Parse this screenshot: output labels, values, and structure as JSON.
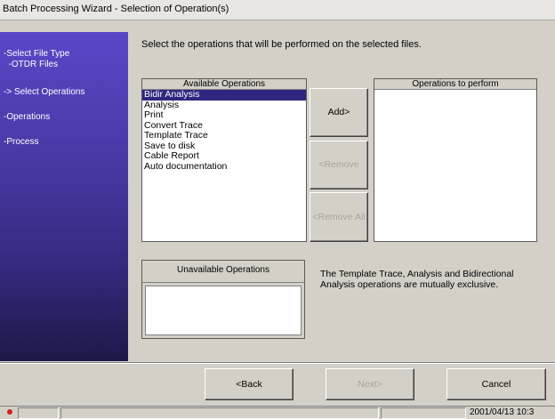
{
  "window": {
    "title": "Batch Processing Wizard - Selection of Operation(s)"
  },
  "sidebar": {
    "steps": [
      {
        "label": "-Select File Type"
      },
      {
        "label": "  -OTDR Files"
      },
      {
        "label": "-> Select Operations"
      },
      {
        "label": "-Operations"
      },
      {
        "label": "-Process"
      }
    ]
  },
  "main": {
    "instruction": "Select the operations that will be performed on the selected files.",
    "available": {
      "header": "Available Operations",
      "items": [
        "Bidir Analysis",
        "Analysis",
        "Print",
        "Convert Trace",
        "Template Trace",
        "Save to disk",
        "Cable Report",
        "Auto documentation"
      ],
      "selected_index": 0
    },
    "to_perform": {
      "header": "Operations to perform",
      "items": []
    },
    "unavailable": {
      "header": "Unavailable Operations",
      "items": []
    },
    "buttons": {
      "add": "Add>",
      "remove": "<Remove",
      "remove_all": "<Remove All"
    },
    "note": "The Template Trace, Analysis and Bidirectional Analysis operations are mutually exclusive."
  },
  "footer": {
    "back": "<Back",
    "next": "Next>",
    "cancel": "Cancel"
  },
  "statusbar": {
    "datetime": "2001/04/13 10:3"
  },
  "colors": {
    "selection": "#2f2680",
    "sidebar_top": "#5848c8",
    "sidebar_bottom": "#1d1848"
  }
}
